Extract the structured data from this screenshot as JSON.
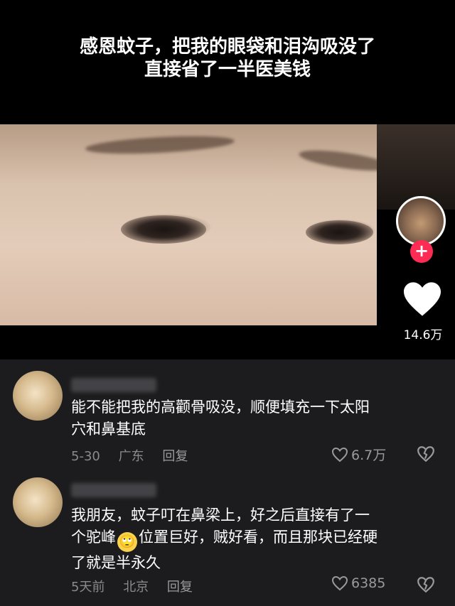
{
  "video": {
    "caption_line1": "感恩蚊子，把我的眼袋和泪沟吸没了",
    "caption_line2": "直接省了一半医美钱",
    "like_count": "14.6万"
  },
  "comments": [
    {
      "text_line1": "能不能把我的高颧骨吸没，顺便填充一下太阳",
      "text_line2": "穴和鼻基底",
      "date": "5-30",
      "location": "广东",
      "reply_label": "回复",
      "likes": "6.7万"
    },
    {
      "text_line1": "我朋友，蚊子叮在鼻梁上，好之后直接有了一",
      "text_line2_before_emoji": "个驼峰",
      "emoji": "🙄",
      "text_line2_after_emoji": "位置巨好，贼好看，而且那块已经硬",
      "text_line3": "了就是半永久",
      "date": "5天前",
      "location": "北京",
      "reply_label": "回复",
      "likes": "6385"
    }
  ]
}
